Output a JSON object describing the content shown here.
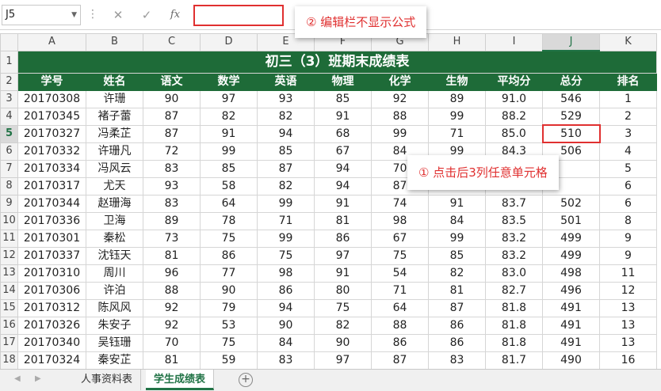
{
  "formula_bar": {
    "name_box": "J5",
    "cancel_icon": "close-icon",
    "enter_icon": "check-icon",
    "fx_label": "fx",
    "formula_value": ""
  },
  "annotations": {
    "callout_formula": "② 编辑栏不显示公式",
    "callout_cell": "① 点击后3列任意单元格"
  },
  "grid": {
    "columns": [
      "A",
      "B",
      "C",
      "D",
      "E",
      "F",
      "G",
      "H",
      "I",
      "J",
      "K"
    ],
    "selected_column": "J",
    "selected_row": 5,
    "title": "初三（3）班期末成绩表",
    "headers": [
      "学号",
      "姓名",
      "语文",
      "数学",
      "英语",
      "物理",
      "化学",
      "生物",
      "平均分",
      "总分",
      "排名"
    ],
    "rows": [
      [
        "20170308",
        "许珊",
        "90",
        "97",
        "93",
        "85",
        "92",
        "89",
        "91.0",
        "546",
        "1"
      ],
      [
        "20170345",
        "褚子蕾",
        "87",
        "82",
        "82",
        "91",
        "88",
        "99",
        "88.2",
        "529",
        "2"
      ],
      [
        "20170327",
        "冯柔芷",
        "87",
        "91",
        "94",
        "68",
        "99",
        "71",
        "85.0",
        "510",
        "3"
      ],
      [
        "20170332",
        "许珊凡",
        "72",
        "99",
        "85",
        "67",
        "84",
        "99",
        "84.3",
        "506",
        "4"
      ],
      [
        "20170334",
        "冯风云",
        "83",
        "85",
        "87",
        "94",
        "70",
        "",
        "",
        "",
        "5"
      ],
      [
        "20170317",
        "尤天",
        "93",
        "58",
        "82",
        "94",
        "87",
        "",
        "",
        "",
        "6"
      ],
      [
        "20170344",
        "赵珊海",
        "83",
        "64",
        "99",
        "91",
        "74",
        "91",
        "83.7",
        "502",
        "6"
      ],
      [
        "20170336",
        "卫海",
        "89",
        "78",
        "71",
        "81",
        "98",
        "84",
        "83.5",
        "501",
        "8"
      ],
      [
        "20170301",
        "秦松",
        "73",
        "75",
        "99",
        "86",
        "67",
        "99",
        "83.2",
        "499",
        "9"
      ],
      [
        "20170337",
        "沈钰天",
        "81",
        "86",
        "75",
        "97",
        "75",
        "85",
        "83.2",
        "499",
        "9"
      ],
      [
        "20170310",
        "周川",
        "96",
        "77",
        "98",
        "91",
        "54",
        "82",
        "83.0",
        "498",
        "11"
      ],
      [
        "20170306",
        "许泊",
        "88",
        "90",
        "86",
        "80",
        "71",
        "81",
        "82.7",
        "496",
        "12"
      ],
      [
        "20170312",
        "陈风风",
        "92",
        "79",
        "94",
        "75",
        "64",
        "87",
        "81.8",
        "491",
        "13"
      ],
      [
        "20170326",
        "朱安子",
        "92",
        "53",
        "90",
        "82",
        "88",
        "86",
        "81.8",
        "491",
        "13"
      ],
      [
        "20170340",
        "吴钰珊",
        "70",
        "75",
        "84",
        "90",
        "86",
        "86",
        "81.8",
        "491",
        "13"
      ],
      [
        "20170324",
        "秦安芷",
        "81",
        "59",
        "83",
        "97",
        "87",
        "83",
        "81.7",
        "490",
        "16"
      ]
    ]
  },
  "sheets": {
    "tabs": [
      "人事资料表",
      "学生成绩表"
    ],
    "active": "学生成绩表"
  },
  "colors": {
    "header_green": "#1e6b38",
    "highlight_red": "#e03030",
    "excel_green": "#217346"
  }
}
